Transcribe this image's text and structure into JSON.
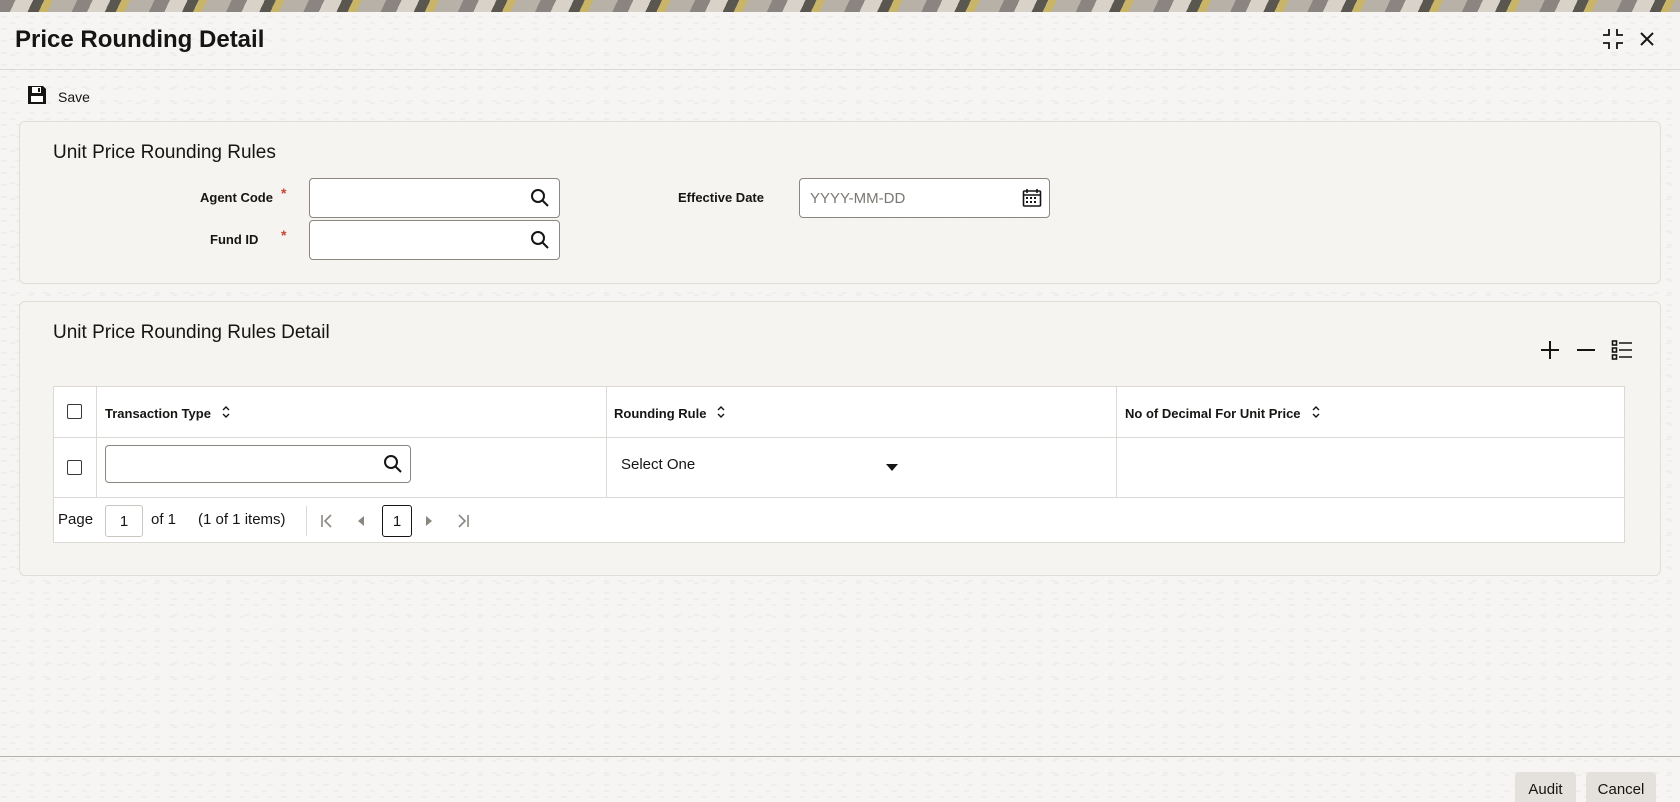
{
  "window": {
    "title": "Price Rounding Detail",
    "maximize_icon": "maximize-icon",
    "close_icon": "close-icon"
  },
  "toolbar": {
    "save_label": "Save",
    "save_icon": "save-icon"
  },
  "section1": {
    "title": "Unit Price Rounding Rules",
    "agent_code": {
      "label": "Agent Code",
      "required": "*",
      "value": ""
    },
    "fund_id": {
      "label": "Fund ID",
      "required": "*",
      "value": ""
    },
    "effective_date": {
      "label": "Effective Date",
      "placeholder": "YYYY-MM-DD",
      "value": ""
    }
  },
  "section2": {
    "title": "Unit Price Rounding Rules Detail",
    "tools": [
      "add-row-icon",
      "delete-row-icon",
      "single-record-view-icon"
    ],
    "columns": [
      "Transaction Type",
      "Rounding Rule",
      "No of Decimal For Unit Price"
    ],
    "rows": [
      {
        "transaction_type": "",
        "rounding_rule": "Select One",
        "no_of_decimal": ""
      }
    ],
    "pager": {
      "page_label": "Page",
      "page_value": "1",
      "of_label": "of 1",
      "items_label": "(1 of 1 items)",
      "current_page": "1"
    }
  },
  "footer": {
    "audit_label": "Audit",
    "cancel_label": "Cancel"
  }
}
